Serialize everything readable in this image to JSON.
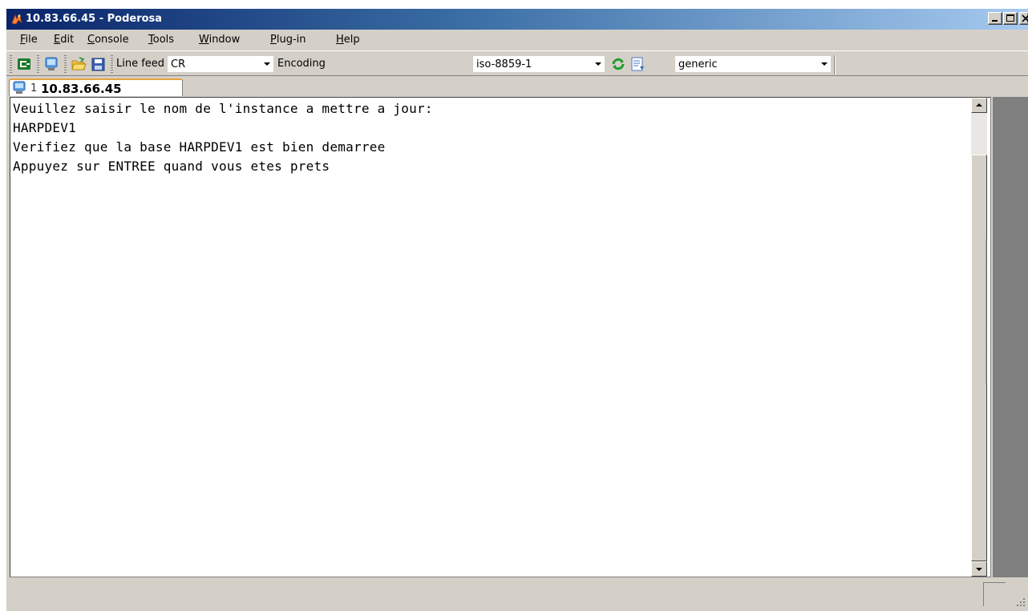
{
  "window": {
    "title": "10.83.66.45 - Poderosa",
    "controls": [
      "minimize-icon",
      "maximize-icon",
      "close-icon"
    ]
  },
  "menubar": {
    "items": [
      {
        "label": "File",
        "accel": "F",
        "rest": "ile"
      },
      {
        "label": "Edit",
        "accel": "E",
        "rest": "dit"
      },
      {
        "label": "Console",
        "accel": "C",
        "rest": "onsole"
      },
      {
        "label": "Tools",
        "accel": "T",
        "rest": "ools"
      },
      {
        "label": "Window",
        "accel": "W",
        "rest": "indow"
      },
      {
        "label": "Plug-in",
        "accel": "P",
        "rest": "lug-in"
      },
      {
        "label": "Help",
        "accel": "H",
        "rest": "elp"
      }
    ]
  },
  "toolbar": {
    "icons": [
      "new-connection-icon",
      "session-icon",
      "open-folder-icon",
      "save-icon",
      "refresh-icon",
      "terminal-settings-icon"
    ],
    "line_feed_label": "Line feed",
    "line_feed_value": "CR",
    "encoding_label": "Encoding",
    "encoding_value": "iso-8859-1",
    "terminal_type_value": "generic"
  },
  "tabs": [
    {
      "number": "1",
      "host": "10.83.66.45",
      "active": true
    }
  ],
  "terminal": {
    "lines": [
      "Veuillez saisir le nom de l'instance a mettre a jour:",
      "HARPDEV1",
      "Verifiez que la base HARPDEV1 est bien demarree",
      "Appuyez sur ENTREE quand vous etes prets"
    ]
  },
  "colors": {
    "titlebar_start": "#0a246a",
    "titlebar_end": "#a6caf0",
    "chrome": "#d4d0c8",
    "tab_accent": "#e8a33a"
  }
}
